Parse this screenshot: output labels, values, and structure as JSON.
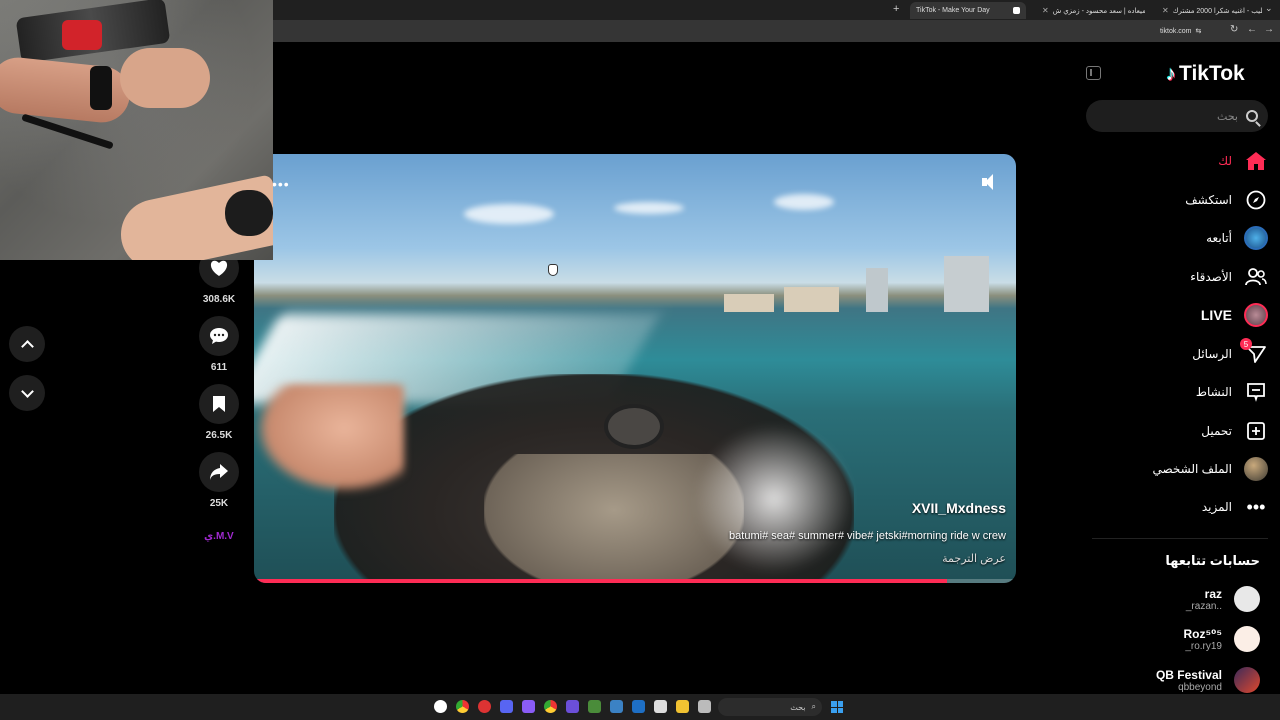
{
  "browser": {
    "tabs": [
      {
        "title": "كليب - اغنيه شكرا 2000 مشترك ..."
      },
      {
        "title": "لا ميعاده | سعد محسود - زمزي ش..."
      },
      {
        "title": "TikTok - Make Your Day"
      }
    ],
    "new_tab": "+",
    "url": "tiktok.com"
  },
  "sidebar": {
    "logo": "TikTok",
    "search_placeholder": "بحث",
    "nav": [
      {
        "label": "لك",
        "icon": "home-icon"
      },
      {
        "label": "استكشف",
        "icon": "compass-icon"
      },
      {
        "label": "أتابعه",
        "icon": "avatar"
      },
      {
        "label": "الأصدقاء",
        "icon": "friends-icon"
      },
      {
        "label": "LIVE",
        "icon": "live-icon"
      },
      {
        "label": "الرسائل",
        "icon": "send-icon",
        "badge": "5"
      },
      {
        "label": "النشاط",
        "icon": "activity-icon"
      },
      {
        "label": "تحميل",
        "icon": "upload-icon"
      },
      {
        "label": "الملف الشخصي",
        "icon": "profile-avatar"
      },
      {
        "label": "المزيد",
        "icon": "more-icon"
      }
    ],
    "following_title": "حسابات تتابعها",
    "following": [
      {
        "name": "raz",
        "handle": "_razan.."
      },
      {
        "name": "Roz⁵⁰⁵",
        "handle": "_ro.ry19"
      },
      {
        "name": "QB Festival",
        "handle": "qbbeyond"
      }
    ]
  },
  "video": {
    "author": "XVII_Mxdness",
    "caption": "batumi# sea# summer# vibe# jetski#morning ride w crew",
    "translate": "عرض الترجمة",
    "more": "•••",
    "progress": 0.91
  },
  "actions": {
    "likes": "308.6K",
    "comments": "611",
    "saves": "26.5K",
    "shares": "25K",
    "music_label": "ي.M.V"
  },
  "taskbar": {
    "search_placeholder": "بحث"
  },
  "colors": {
    "accent": "#fe2c55",
    "background": "#000000",
    "surface": "#1f1f1f"
  }
}
